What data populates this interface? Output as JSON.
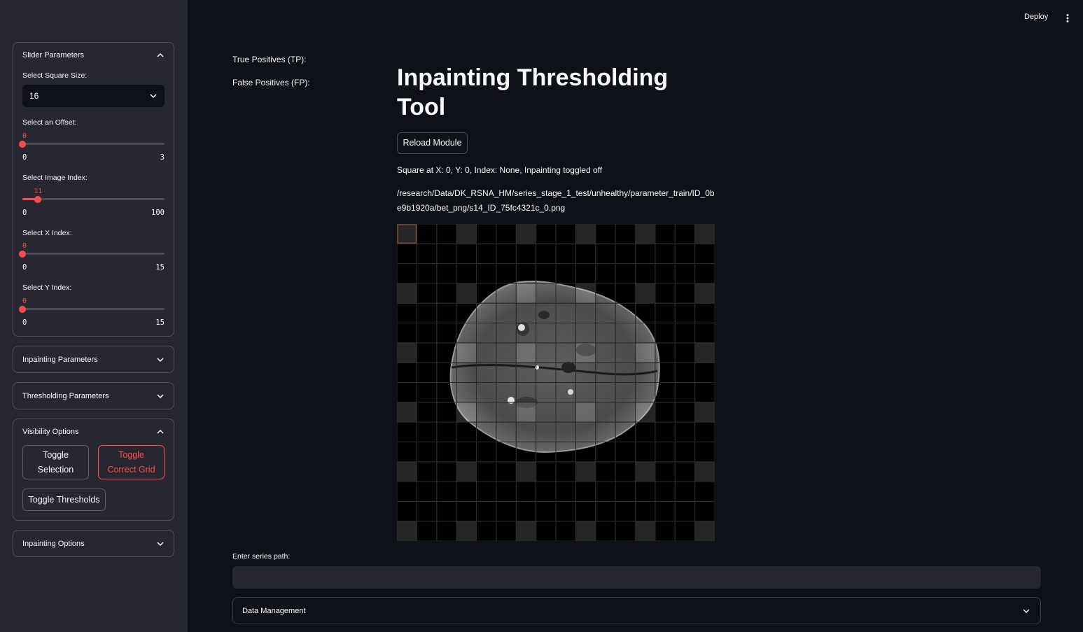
{
  "header": {
    "deploy_label": "Deploy",
    "menu_icon": "kebab-menu-icon"
  },
  "sidebar": {
    "slider_parameters": {
      "title": "Slider Parameters",
      "square_size": {
        "label": "Select Square Size:",
        "value": "16"
      },
      "offset": {
        "label": "Select an Offset:",
        "value": "0",
        "min": "0",
        "max": "3",
        "fraction": 0.0
      },
      "image_index": {
        "label": "Select Image Index:",
        "value": "11",
        "min": "0",
        "max": "100",
        "fraction": 0.11
      },
      "x_index": {
        "label": "Select X Index:",
        "value": "0",
        "min": "0",
        "max": "15",
        "fraction": 0.0
      },
      "y_index": {
        "label": "Select Y Index:",
        "value": "0",
        "min": "0",
        "max": "15",
        "fraction": 0.0
      }
    },
    "inpainting_parameters": {
      "title": "Inpainting Parameters"
    },
    "thresholding_parameters": {
      "title": "Thresholding Parameters"
    },
    "visibility_options": {
      "title": "Visibility Options",
      "toggle_selection_line1": "Toggle",
      "toggle_selection_line2": "Selection",
      "toggle_correct_grid_line1": "Toggle",
      "toggle_correct_grid_line2": "Correct Grid",
      "toggle_thresholds": "Toggle Thresholds"
    },
    "inpainting_options": {
      "title": "Inpainting Options"
    }
  },
  "main": {
    "tp_label": "True Positives (TP):",
    "fp_label": "False Positives (FP):",
    "title_line1": "Inpainting Thresholding",
    "title_line2": "Tool",
    "reload_button": "Reload Module",
    "status_text": "Square at X: 0, Y: 0, Index: None, Inpainting toggled off",
    "image_path": "/research/Data/DK_RSNA_HM/series_stage_1_test/unhealthy/parameter_train/ID_0be9b1920a/bet_png/s14_ID_75fc4321c_0.png",
    "series_path_label": "Enter series path:",
    "series_path_value": "",
    "data_management": "Data Management"
  },
  "colors": {
    "accent": "#ff4b4b",
    "background": "#0e1117",
    "sidebar": "#262730"
  }
}
